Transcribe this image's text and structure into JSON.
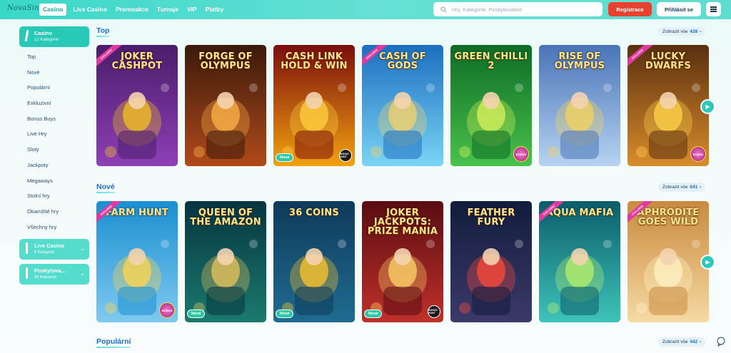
{
  "header": {
    "logo": "NovaSin",
    "nav": [
      "Casino",
      "Live Casino",
      "Promoakce",
      "Turnaje",
      "VIP",
      "Platby"
    ],
    "search_placeholder": "Hry, Kategorie, Poskytovatelé",
    "register_label": "Registrace",
    "login_label": "Přihlásit se"
  },
  "sidebar": {
    "active": {
      "title": "Casino",
      "subtitle": "12 Kategorie"
    },
    "items": [
      "Top",
      "Nové",
      "Populární",
      "Exkluzivní",
      "Bonus Buys",
      "Live Hry",
      "Sloty",
      "Jackpoty",
      "Megaways",
      "Stolní hry",
      "Okamžité hry",
      "Všechny hry"
    ],
    "groups": [
      {
        "title": "Live Casino",
        "subtitle": "8 Kategorie"
      },
      {
        "title": "Poskytova...",
        "subtitle": "93 Kategorie"
      }
    ]
  },
  "sections": [
    {
      "title": "Top",
      "show_all_label": "Zobrazit vše",
      "count": "428",
      "games": [
        {
          "name": "Joker Cashpot",
          "ribbon": "EXCLUSIVE",
          "colors": [
            "#4a1d6b",
            "#8e3fb5"
          ],
          "accent": "#f4c21f"
        },
        {
          "name": "Forge of Olympus",
          "colors": [
            "#3a1a0c",
            "#b04a1a"
          ],
          "accent": "#ffb347"
        },
        {
          "name": "Cash Link Hold & Win",
          "new": "Nové",
          "hunt": "BONUS HUNT",
          "colors": [
            "#7a0e0e",
            "#f2a10f"
          ],
          "accent": "#ffd23f"
        },
        {
          "name": "Cash of Gods",
          "ribbon": "EXCLUSIVE",
          "colors": [
            "#1c6fbf",
            "#7ad4f5"
          ],
          "accent": "#f5d26a"
        },
        {
          "name": "Green Chilli 2",
          "bonus": "BONUS",
          "colors": [
            "#0d6b26",
            "#49c24a"
          ],
          "accent": "#d8f25a"
        },
        {
          "name": "Rise of Olympus",
          "colors": [
            "#4a74b8",
            "#b6d3f0"
          ],
          "accent": "#f6d35b"
        },
        {
          "name": "Lucky Dwarfs",
          "ribbon": "EXCLUSIVE",
          "bonus": "BONUS",
          "colors": [
            "#5a2f10",
            "#d98c2b"
          ],
          "accent": "#ffd34a"
        }
      ]
    },
    {
      "title": "Nové",
      "show_all_label": "Zobrazit vše",
      "count": "641",
      "games": [
        {
          "name": "Farm Hunt",
          "ribbon": "EXCLUSIVE",
          "bonus": "BONUS",
          "colors": [
            "#1b8fd1",
            "#7ec9ef"
          ],
          "accent": "#ffd54a"
        },
        {
          "name": "Queen of the Amazon",
          "new": "Nové",
          "colors": [
            "#063542",
            "#1b7a6e"
          ],
          "accent": "#e8c45c"
        },
        {
          "name": "36 Coins",
          "new": "Nové",
          "colors": [
            "#0e3a5a",
            "#1f6c91"
          ],
          "accent": "#ffc629"
        },
        {
          "name": "Joker Jackpots: Prize Mania",
          "new": "Nové",
          "hunt": "BONUS HUNT",
          "colors": [
            "#5a0d12",
            "#c0302a"
          ],
          "accent": "#ffd56a"
        },
        {
          "name": "Feather Fury",
          "colors": [
            "#121c3c",
            "#3b3a6a"
          ],
          "accent": "#ff4a3a"
        },
        {
          "name": "Aqua Mafia",
          "ribbon": "EXCLUSIVE",
          "colors": [
            "#0b5d6a",
            "#3ec3b9"
          ],
          "accent": "#b8f06a"
        },
        {
          "name": "Aphrodite Goes Wild",
          "ribbon": "EXCLUSIVE",
          "colors": [
            "#c98a3e",
            "#f6d9a3"
          ],
          "accent": "#fff3c4"
        }
      ]
    },
    {
      "title": "Populární",
      "show_all_label": "Zobrazit vše",
      "count": "442"
    }
  ]
}
